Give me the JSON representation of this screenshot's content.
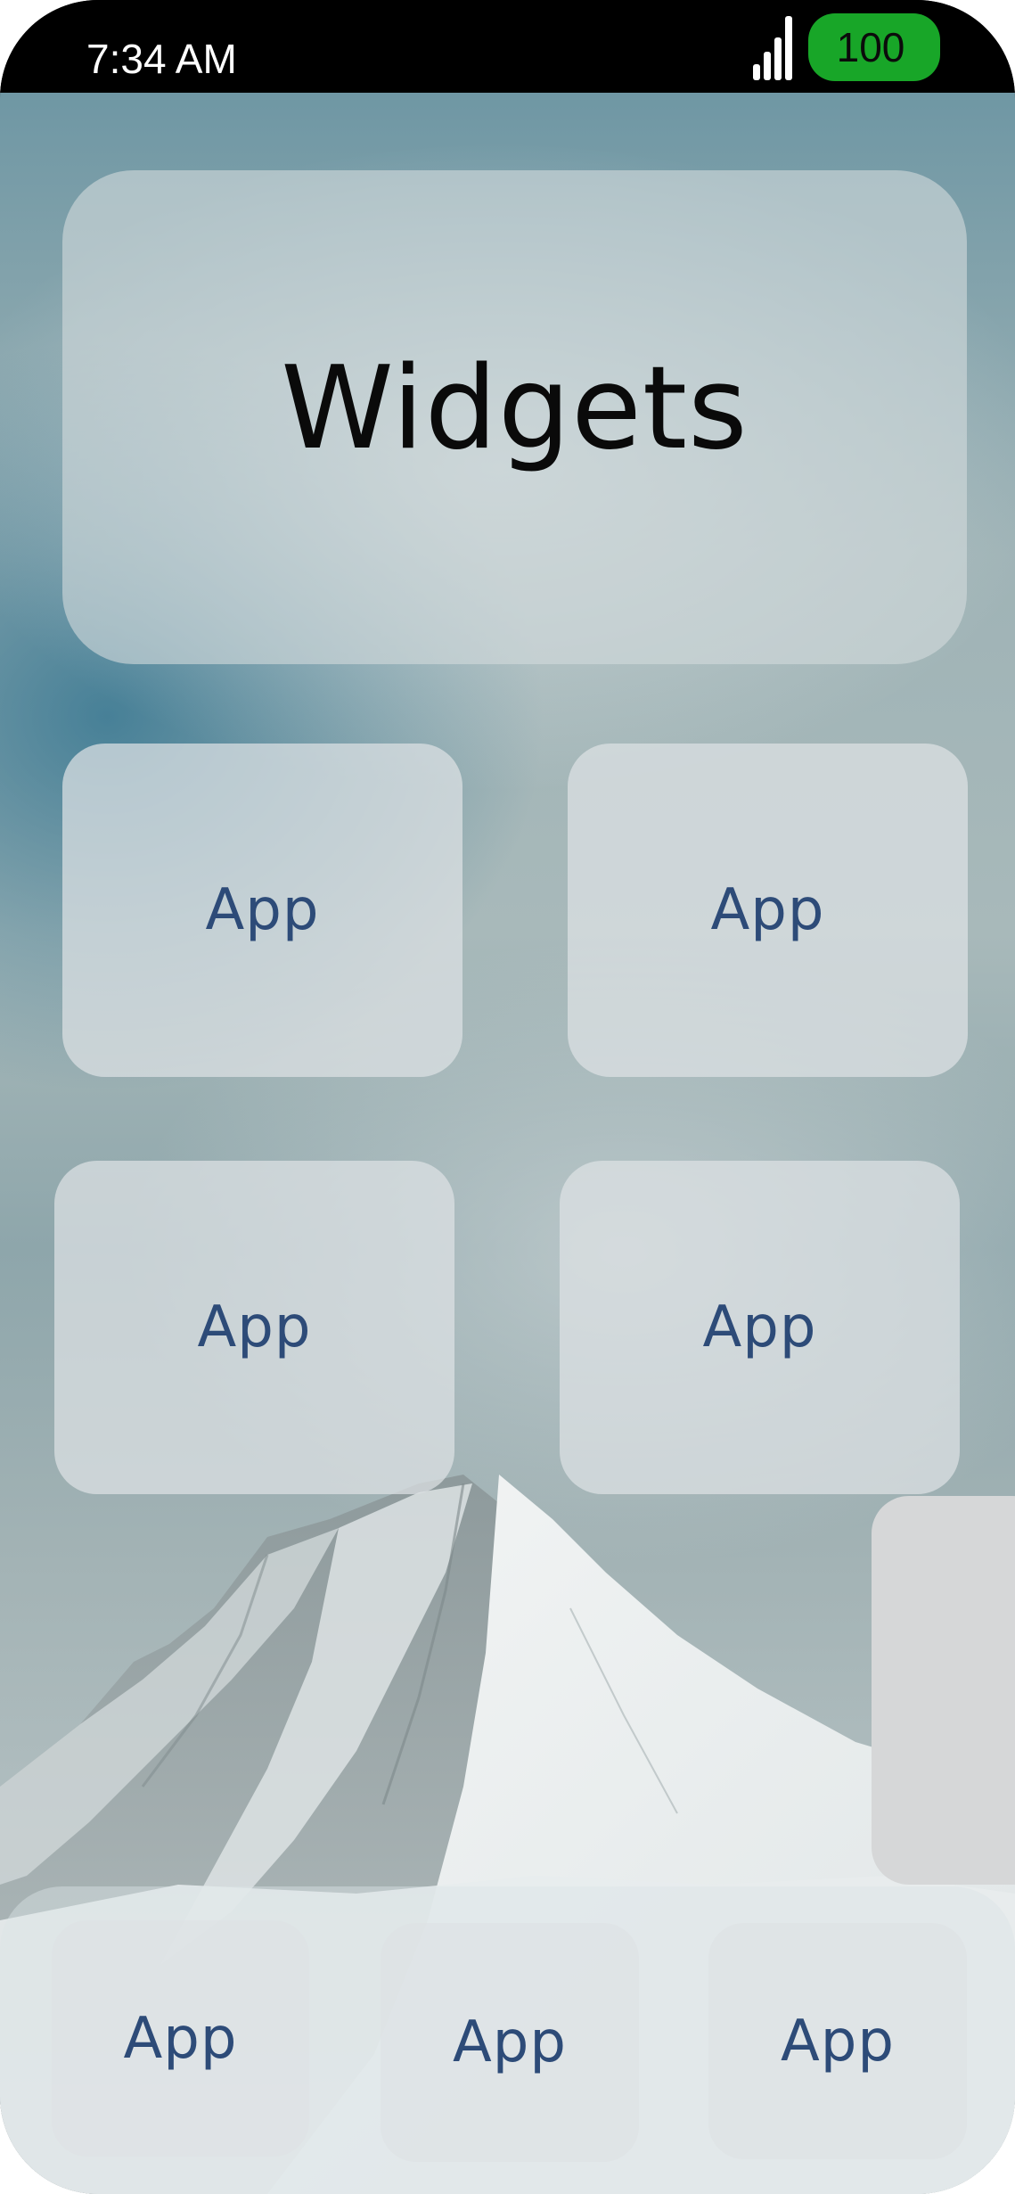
{
  "status_bar": {
    "time": "7:34 AM",
    "battery_level": "100",
    "battery_color": "#18a628",
    "signal_icon": "cellular-signal-icon"
  },
  "widget": {
    "label": "Widgets"
  },
  "home_apps": [
    {
      "label": "App"
    },
    {
      "label": "App"
    },
    {
      "label": "App"
    },
    {
      "label": "App"
    }
  ],
  "dock_apps": [
    {
      "label": "App"
    },
    {
      "label": "App"
    },
    {
      "label": "App"
    }
  ],
  "colors": {
    "app_label": "#2d4b78",
    "widget_label": "#0a0a0a",
    "status_bar_background": "#000000"
  }
}
